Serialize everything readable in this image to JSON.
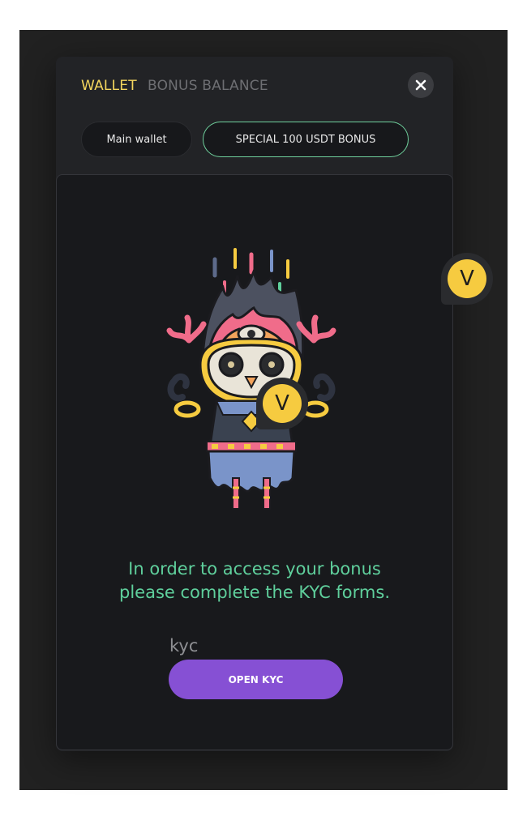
{
  "tabs": {
    "wallet": "WALLET",
    "bonus_balance": "BONUS BALANCE"
  },
  "pills": {
    "main_wallet": "Main wallet",
    "special_bonus": "SPECIAL 100 USDT BONUS"
  },
  "message": {
    "line1": "In order to access your bonus",
    "line2": "please complete the KYC forms."
  },
  "kyc": {
    "label": "kyc",
    "button": "OPEN KYC"
  },
  "badges": {
    "side": "V",
    "center": "V"
  },
  "colors": {
    "accent_yellow": "#f5d75e",
    "accent_green": "#5fcf9c",
    "button_purple": "#8650d4",
    "badge_yellow": "#f6cb40"
  },
  "icons": {
    "close": "close-icon",
    "illustration": "mascot-illustration"
  }
}
